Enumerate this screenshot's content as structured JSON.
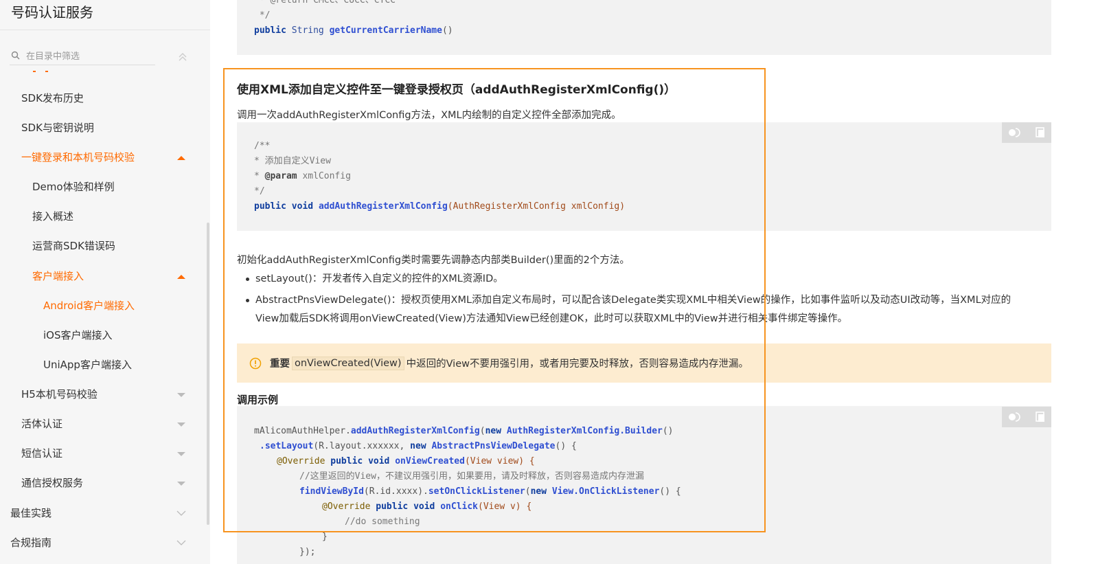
{
  "sidebar": {
    "title": "号码认证服务",
    "search_placeholder": "在目录中筛选",
    "items": [
      {
        "label": "SDK发布历史"
      },
      {
        "label": "SDK与密钥说明"
      },
      {
        "label": "一键登录和本机号码校验"
      },
      {
        "label": "Demo体验和样例"
      },
      {
        "label": "接入概述"
      },
      {
        "label": "运营商SDK错误码"
      },
      {
        "label": "客户端接入"
      },
      {
        "label": "Android客户端接入"
      },
      {
        "label": "iOS客户端接入"
      },
      {
        "label": "UniApp客户端接入"
      },
      {
        "label": "H5本机号码校验"
      },
      {
        "label": "活体认证"
      },
      {
        "label": "短信认证"
      },
      {
        "label": "通信授权服务"
      },
      {
        "label": "最佳实践"
      },
      {
        "label": "合规指南"
      }
    ],
    "accent_color": "#ff6a00"
  },
  "top_code": {
    "line1": " * @return CMCC、CUCC、CTCC",
    "line2": " */",
    "line3_kw": "public",
    "line3_type": "String",
    "line3_fn": "getCurrentCarrierName",
    "line3_rest": "()"
  },
  "section": {
    "title": "使用XML添加自定义控件至一键登录授权页（addAuthRegisterXmlConfig()）",
    "intro": "调用一次addAuthRegisterXmlConfig方法，XML内绘制的自定义控件全部添加完成。",
    "code1": {
      "l1": "/**",
      "l2": "* 添加自定义View",
      "l3_tag": "@param",
      "l3_rest": " xmlConfig",
      "l4": "*/",
      "l5_kw1": "public",
      "l5_kw2": "void",
      "l5_fn": "addAuthRegisterXmlConfig",
      "l5_args": "(AuthRegisterXmlConfig xmlConfig)"
    },
    "para2": "初始化addAuthRegisterXmlConfig类时需要先调静态内部类Builder()里面的2个方法。",
    "bullets": [
      "setLayout()：开发者传入自定义的控件的XML资源ID。",
      "AbstractPnsViewDelegate()：授权页使用XML添加自定义布局时，可以配合该Delegate类实现XML中相关View的操作，比如事件监听以及动态UI改动等，当XML对应的",
      "View加载后SDK将调用onViewCreated(View)方法通知View已经创建OK，此时可以获取XML中的View并进行相关事件绑定等操作。"
    ],
    "notice": {
      "label": "重要",
      "code": "onViewCreated(View)",
      "text": "中返回的View不要用强引用，或者用完要及时释放，否则容易造成内存泄漏。"
    },
    "example_heading": "调用示例",
    "code2": {
      "l1_obj": "mAlicomAuthHelper.",
      "l1_fn": "addAuthRegisterXmlConfig",
      "l1_p1": "(",
      "l1_kw": "new",
      "l1_type": "AuthRegisterXmlConfig.Builder",
      "l1_end": "()",
      "l2_fn": ".setLayout",
      "l2_p1": "(R.layout.xxxxxx, ",
      "l2_kw": "new",
      "l2_type": "AbstractPnsViewDelegate",
      "l2_end": "() {",
      "l3_ann": "@Override",
      "l3_kw1": "public",
      "l3_kw2": "void",
      "l3_fn": "onViewCreated",
      "l3_args": "(View view) {",
      "l4": "//这里返回的View，不建议用强引用，如果要用，请及时释放，否则容易造成内存泄漏",
      "l5_fn": "findViewById",
      "l5_p1": "(R.id.xxxx).",
      "l5_fn2": "setOnClickListener",
      "l5_p2": "(",
      "l5_kw": "new",
      "l5_type": "View.OnClickListener",
      "l5_end": "() {",
      "l6_ann": "@Override",
      "l6_kw1": "public",
      "l6_kw2": "void",
      "l6_fn": "onClick",
      "l6_args": "(View v) {",
      "l7": "//do something",
      "l8": "}",
      "l9": "});"
    }
  }
}
